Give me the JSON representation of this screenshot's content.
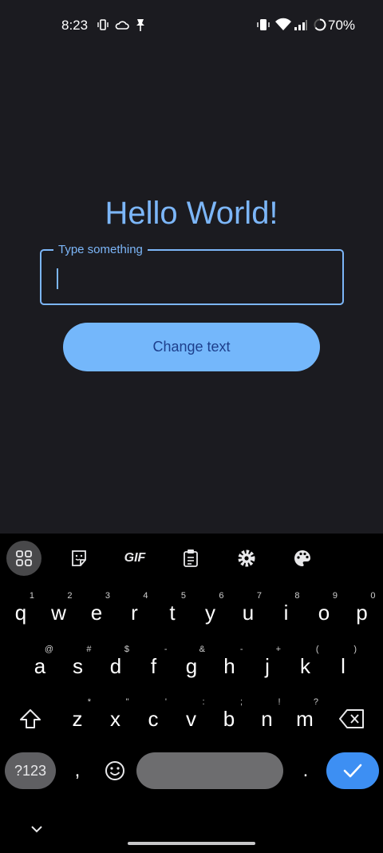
{
  "status_bar": {
    "time": "8:23",
    "battery": "70%",
    "icons": [
      "vibrate-icon",
      "cloud-icon",
      "pin-icon",
      "vibrate-mode-icon",
      "wifi-icon",
      "signal-icon",
      "battery-icon"
    ]
  },
  "app": {
    "title": "Hello World!",
    "input": {
      "label": "Type something",
      "value": ""
    },
    "button_label": "Change text"
  },
  "keyboard": {
    "toolbar": [
      "apps-grid-icon",
      "sticker-icon",
      "GIF",
      "clipboard-icon",
      "settings-icon",
      "palette-icon"
    ],
    "gif_label": "GIF",
    "row1": [
      {
        "ch": "q",
        "hint": "1"
      },
      {
        "ch": "w",
        "hint": "2"
      },
      {
        "ch": "e",
        "hint": "3"
      },
      {
        "ch": "r",
        "hint": "4"
      },
      {
        "ch": "t",
        "hint": "5"
      },
      {
        "ch": "y",
        "hint": "6"
      },
      {
        "ch": "u",
        "hint": "7"
      },
      {
        "ch": "i",
        "hint": "8"
      },
      {
        "ch": "o",
        "hint": "9"
      },
      {
        "ch": "p",
        "hint": "0"
      }
    ],
    "row2": [
      {
        "ch": "a",
        "hint": "@"
      },
      {
        "ch": "s",
        "hint": "#"
      },
      {
        "ch": "d",
        "hint": "$"
      },
      {
        "ch": "f",
        "hint": "-"
      },
      {
        "ch": "g",
        "hint": "&"
      },
      {
        "ch": "h",
        "hint": "-"
      },
      {
        "ch": "j",
        "hint": "+"
      },
      {
        "ch": "k",
        "hint": "("
      },
      {
        "ch": "l",
        "hint": ")"
      }
    ],
    "row3": [
      {
        "ch": "z",
        "hint": "*"
      },
      {
        "ch": "x",
        "hint": "\""
      },
      {
        "ch": "c",
        "hint": "'"
      },
      {
        "ch": "v",
        "hint": ":"
      },
      {
        "ch": "b",
        "hint": ";"
      },
      {
        "ch": "n",
        "hint": "!"
      },
      {
        "ch": "m",
        "hint": "?"
      }
    ],
    "symbols_label": "?123",
    "comma": ",",
    "period": "."
  },
  "colors": {
    "background": "#1b1b20",
    "accent": "#7cb6f8",
    "button_fill": "#74b7fb",
    "button_text": "#1d3f8c",
    "enter_key": "#3d8ff3"
  }
}
